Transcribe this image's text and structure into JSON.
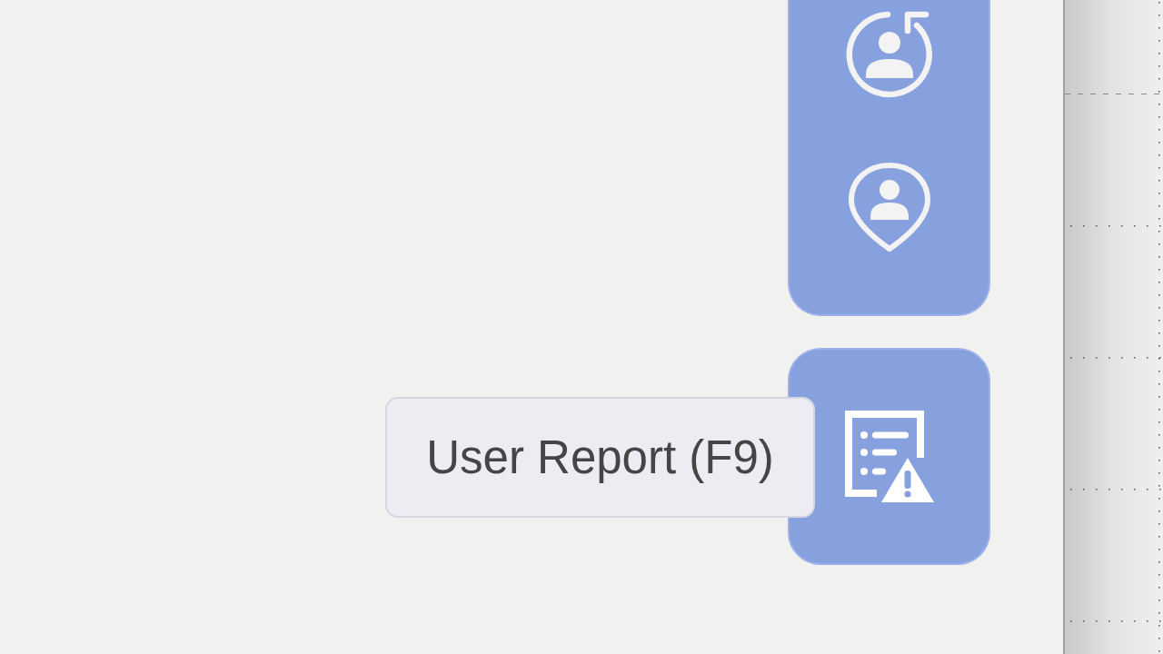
{
  "report_button": {
    "tooltip": "User Report (F9)"
  }
}
